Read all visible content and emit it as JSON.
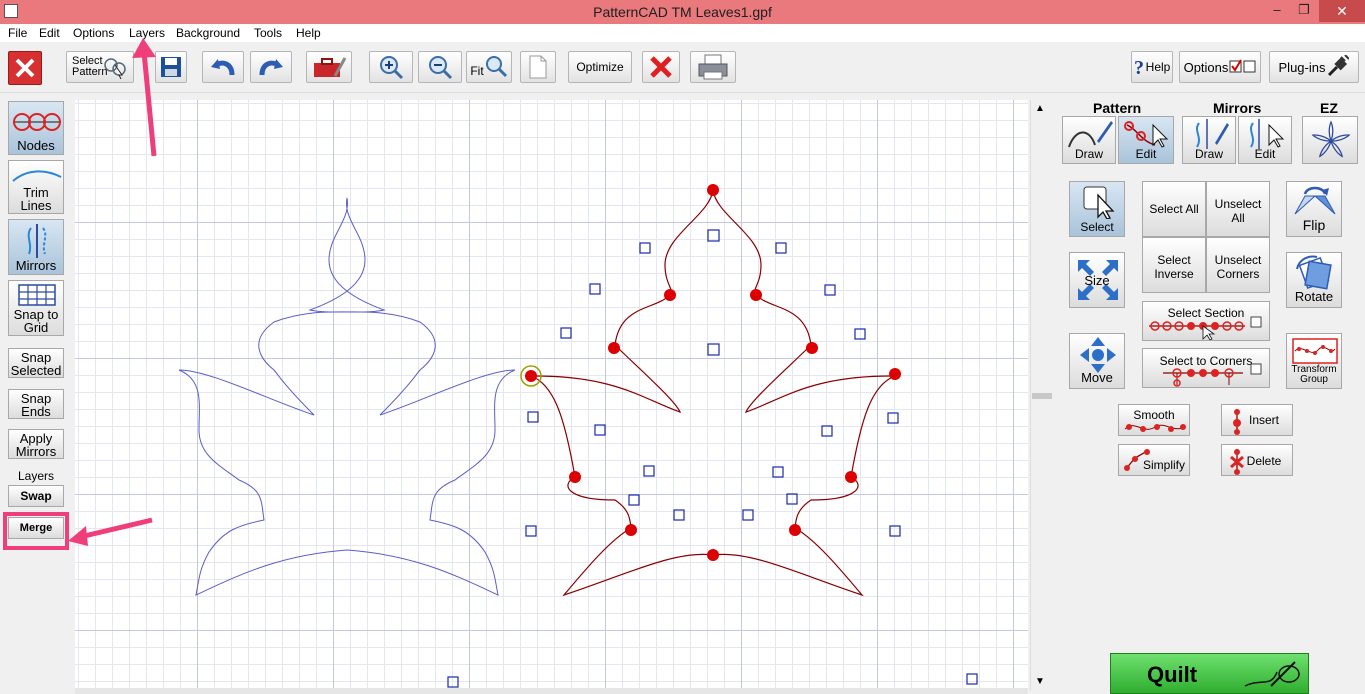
{
  "window": {
    "title": "PatternCAD TM     Leaves1.gpf",
    "minimize": "–",
    "maximize": "❐",
    "close": "✕"
  },
  "menu": [
    "File",
    "Edit",
    "Options",
    "Layers",
    "Background",
    "Tools",
    "Help"
  ],
  "toolbar": {
    "select_pattern": "Select Pattern",
    "fit": "Fit",
    "optimize": "Optimize",
    "help": "Help",
    "options": "Options",
    "plugins": "Plug-ins"
  },
  "left_panel": {
    "nodes": "Nodes",
    "trim_lines": "Trim Lines",
    "mirrors": "Mirrors",
    "snap_to_grid": "Snap to Grid",
    "snap_selected": "Snap Selected",
    "snap_ends": "Snap Ends",
    "apply_mirrors": "Apply Mirrors",
    "layers_label": "Layers",
    "swap": "Swap",
    "merge": "Merge"
  },
  "right_panel": {
    "pattern_header": "Pattern",
    "mirrors_header": "Mirrors",
    "ez_header": "EZ",
    "pattern_draw": "Draw",
    "pattern_edit": "Edit",
    "mirrors_draw": "Draw",
    "mirrors_edit": "Edit",
    "select": "Select",
    "select_all": "Select All",
    "unselect_all": "Unselect All",
    "select_inverse": "Select Inverse",
    "unselect_corners": "Unselect Corners",
    "flip": "Flip",
    "size": "Size",
    "rotate": "Rotate",
    "select_section": "Select Section",
    "select_to_corners": "Select to Corners",
    "move": "Move",
    "transform_group": "Transform Group",
    "smooth": "Smooth",
    "insert": "Insert",
    "simplify": "Simplify",
    "delete": "Delete",
    "quilt": "Quilt"
  },
  "colors": {
    "titlebar": "#e9797c",
    "accent_pink": "#ef3f7a",
    "node_red": "#dd0000",
    "curve_dark_red": "#8b0000",
    "ghost_blue": "#5a5ec8",
    "quilt_green": "#4fc94f"
  }
}
